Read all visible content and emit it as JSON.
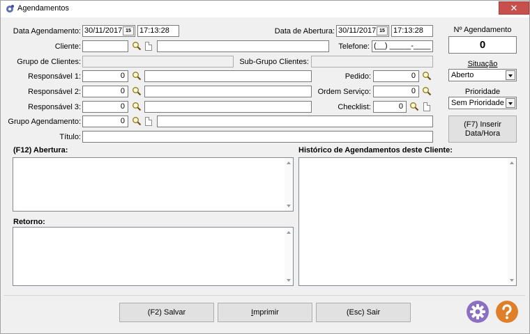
{
  "window": {
    "title": "Agendamentos",
    "close_glyph": "✕"
  },
  "form": {
    "data_agendamento": {
      "label": "Data Agendamento:",
      "date": "30/11/2017",
      "time": "17:13:28"
    },
    "data_abertura": {
      "label": "Data de Abertura:",
      "date": "30/11/2017",
      "time": "17:13:28"
    },
    "cliente": {
      "label": "Cliente:",
      "code": "",
      "name": ""
    },
    "telefone": {
      "label": "Telefone:",
      "value": "(__) _____-____"
    },
    "grupo_clientes": {
      "label": "Grupo de Clientes:",
      "value": ""
    },
    "sub_grupo": {
      "label": "Sub-Grupo Clientes:",
      "value": ""
    },
    "responsavel1": {
      "label": "Responsável 1:",
      "code": "0",
      "name": ""
    },
    "responsavel2": {
      "label": "Responsável 2:",
      "code": "0",
      "name": ""
    },
    "responsavel3": {
      "label": "Responsável 3:",
      "code": "0",
      "name": ""
    },
    "pedido": {
      "label": "Pedido:",
      "value": "0"
    },
    "ordem_servico": {
      "label": "Ordem Serviço:",
      "value": "0"
    },
    "checklist": {
      "label": "Checklist:",
      "value": "0"
    },
    "grupo_agendamento": {
      "label": "Grupo Agendamento:",
      "code": "0",
      "name": ""
    },
    "titulo": {
      "label": "Título:",
      "value": ""
    },
    "calendar_glyph": "15"
  },
  "side": {
    "numero_label": "Nº Agendamento",
    "numero_value": "0",
    "situacao_label": "Situação",
    "situacao_value": "Aberto",
    "prioridade_label": "Prioridade",
    "prioridade_value": "Sem Prioridade",
    "insert_btn_line1": "(F7) Inserir",
    "insert_btn_line2": "Data/Hora"
  },
  "sections": {
    "abertura": "(F12) Abertura:",
    "historico": "Histórico de Agendamentos deste Cliente:",
    "retorno": "Retorno:"
  },
  "buttons": {
    "salvar": "(F2) Salvar",
    "imprimir_first": "I",
    "imprimir_rest": "mprimir",
    "sair": "(Esc) Sair"
  },
  "colors": {
    "accent_purple": "#8a6fc2",
    "accent_orange": "#e07f2a",
    "close_red": "#c7504d"
  }
}
